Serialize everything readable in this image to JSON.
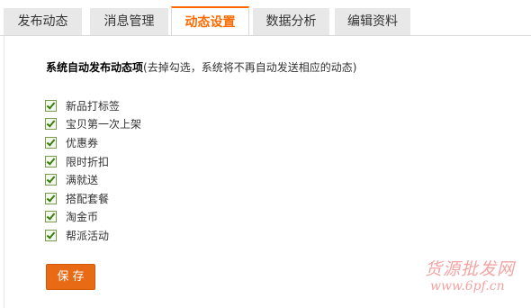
{
  "tabs": [
    {
      "label": "发布动态",
      "active": false
    },
    {
      "label": "消息管理",
      "active": false
    },
    {
      "label": "动态设置",
      "active": true
    },
    {
      "label": "数据分析",
      "active": false
    },
    {
      "label": "编辑资料",
      "active": false
    }
  ],
  "settings": {
    "heading": "系统自动发布动态项",
    "hint": "(去掉勾选，系统将不再自动发送相应的动态)",
    "options": [
      {
        "label": "新品打标签",
        "checked": true
      },
      {
        "label": "宝贝第一次上架",
        "checked": true
      },
      {
        "label": "优惠券",
        "checked": true
      },
      {
        "label": "限时折扣",
        "checked": true
      },
      {
        "label": "满就送",
        "checked": true
      },
      {
        "label": "搭配套餐",
        "checked": true
      },
      {
        "label": "淘金币",
        "checked": true
      },
      {
        "label": "帮派活动",
        "checked": true
      }
    ],
    "save_label": "保存"
  },
  "watermark": {
    "text": "货源批发网",
    "url": "www.6pf.cn"
  },
  "colors": {
    "accent": "#ff6a00",
    "button": "#e86a14",
    "tab_inactive": "#e8e8e8",
    "checkbox_check": "#3a7d0f"
  }
}
